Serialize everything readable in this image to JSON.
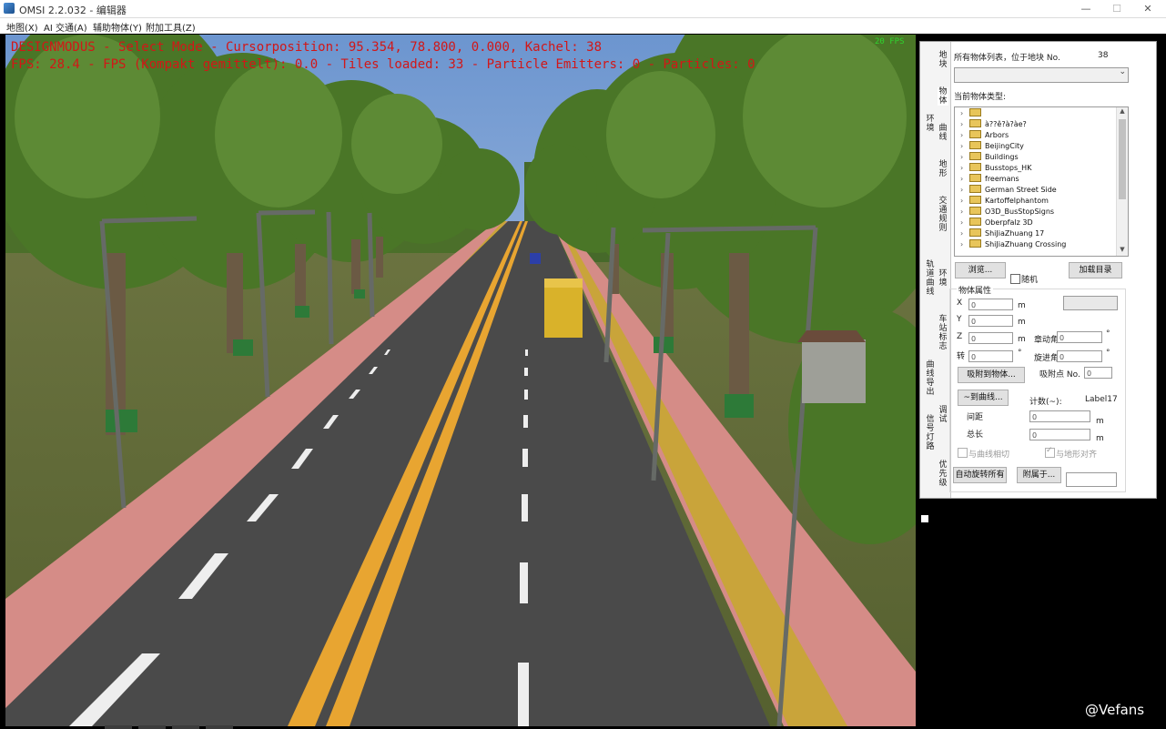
{
  "window": {
    "title": "OMSI 2.2.032 - 编辑器",
    "minimize": "—",
    "maximize": "☐",
    "close": "✕"
  },
  "menu": [
    "地图(X)",
    "AI 交通(A)",
    "辅助物体(Y)",
    "附加工具(Z)"
  ],
  "viewport": {
    "osd_line1": "DESIGNMODUS - Select Mode - Cursorposition: 95.354, 78.800, 0.000, Kachel: 38",
    "osd_line2": "FPS: 28.4 - FPS (Kompakt gemittelt): 0.0 - Tiles loaded: 33 - Particle Emitters: 0 - Particles: 0",
    "fps_badge": "20 FPS",
    "colors": {
      "sky": "#8fb0dd",
      "road": "#4a4a4a",
      "sidewalk": "#d88a86",
      "tactile": "#c9a43a",
      "grass": "#5e6a3a",
      "trees": "#4f7a2c",
      "lane_yellow": "#e8a531"
    }
  },
  "panel": {
    "tabs": [
      "地块",
      "物体",
      "曲线",
      "地形",
      "交通规则",
      "车站标志",
      "调试",
      "环境",
      "轨道曲线",
      "曲线导出",
      "信号灯路",
      "优先级"
    ],
    "objects_list_label": "所有物体列表，位于地块 No.",
    "tile_no": "38",
    "current_type_label": "当前物体类型:",
    "tree_items": [
      "",
      "à??ê?à?àe?",
      "Arbors",
      "BeijingCity",
      "Buildings",
      "Busstops_HK",
      "freemans",
      "German Street Side",
      "Kartoffelphantom",
      "O3D_BusStopSigns",
      "Oberpfalz 3D",
      "ShiJiaZhuang 17",
      "ShiJiaZhuang Crossing"
    ],
    "browse_btn": "浏览...",
    "random_label": "随机",
    "load_catalog_btn": "加载目录",
    "properties_label": "物体属性",
    "x_label": "X",
    "y_label": "Y",
    "z_label": "Z",
    "x_val": "0",
    "y_val": "0",
    "z_val": "0",
    "unit_m": "m",
    "rot_label": "转",
    "rot_val": "0",
    "deg": "°",
    "roll_label": "章动角",
    "roll_val": "0",
    "prec_label": "旋进角",
    "prec_val": "0",
    "snap_obj_btn": "吸附到物体...",
    "snap_pt_label": "吸附点 No.",
    "snap_pt_val": "0",
    "to_curve_btn": "~到曲线...",
    "count_label": "计数(~):",
    "count_val": "Label17",
    "spacing_label": "间距",
    "spacing_val": "0",
    "length_label": "总长",
    "length_val": "0",
    "tangent_label": "与曲线相切",
    "align_label": "与地形对齐",
    "auto_rotate_btn": "自动旋转所有",
    "attach_btn": "附属于..."
  },
  "watermark": "@Vefans"
}
